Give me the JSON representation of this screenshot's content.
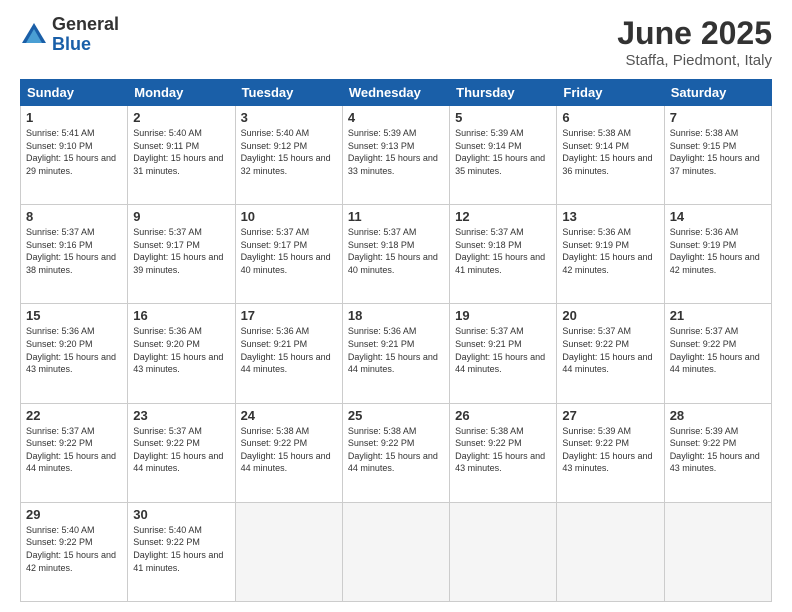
{
  "logo": {
    "general": "General",
    "blue": "Blue"
  },
  "title": {
    "month": "June 2025",
    "location": "Staffa, Piedmont, Italy"
  },
  "weekdays": [
    "Sunday",
    "Monday",
    "Tuesday",
    "Wednesday",
    "Thursday",
    "Friday",
    "Saturday"
  ],
  "days": [
    {
      "num": "1",
      "sunrise": "5:41 AM",
      "sunset": "9:10 PM",
      "daylight": "15 hours and 29 minutes."
    },
    {
      "num": "2",
      "sunrise": "5:40 AM",
      "sunset": "9:11 PM",
      "daylight": "15 hours and 31 minutes."
    },
    {
      "num": "3",
      "sunrise": "5:40 AM",
      "sunset": "9:12 PM",
      "daylight": "15 hours and 32 minutes."
    },
    {
      "num": "4",
      "sunrise": "5:39 AM",
      "sunset": "9:13 PM",
      "daylight": "15 hours and 33 minutes."
    },
    {
      "num": "5",
      "sunrise": "5:39 AM",
      "sunset": "9:14 PM",
      "daylight": "15 hours and 35 minutes."
    },
    {
      "num": "6",
      "sunrise": "5:38 AM",
      "sunset": "9:14 PM",
      "daylight": "15 hours and 36 minutes."
    },
    {
      "num": "7",
      "sunrise": "5:38 AM",
      "sunset": "9:15 PM",
      "daylight": "15 hours and 37 minutes."
    },
    {
      "num": "8",
      "sunrise": "5:37 AM",
      "sunset": "9:16 PM",
      "daylight": "15 hours and 38 minutes."
    },
    {
      "num": "9",
      "sunrise": "5:37 AM",
      "sunset": "9:17 PM",
      "daylight": "15 hours and 39 minutes."
    },
    {
      "num": "10",
      "sunrise": "5:37 AM",
      "sunset": "9:17 PM",
      "daylight": "15 hours and 40 minutes."
    },
    {
      "num": "11",
      "sunrise": "5:37 AM",
      "sunset": "9:18 PM",
      "daylight": "15 hours and 40 minutes."
    },
    {
      "num": "12",
      "sunrise": "5:37 AM",
      "sunset": "9:18 PM",
      "daylight": "15 hours and 41 minutes."
    },
    {
      "num": "13",
      "sunrise": "5:36 AM",
      "sunset": "9:19 PM",
      "daylight": "15 hours and 42 minutes."
    },
    {
      "num": "14",
      "sunrise": "5:36 AM",
      "sunset": "9:19 PM",
      "daylight": "15 hours and 42 minutes."
    },
    {
      "num": "15",
      "sunrise": "5:36 AM",
      "sunset": "9:20 PM",
      "daylight": "15 hours and 43 minutes."
    },
    {
      "num": "16",
      "sunrise": "5:36 AM",
      "sunset": "9:20 PM",
      "daylight": "15 hours and 43 minutes."
    },
    {
      "num": "17",
      "sunrise": "5:36 AM",
      "sunset": "9:21 PM",
      "daylight": "15 hours and 44 minutes."
    },
    {
      "num": "18",
      "sunrise": "5:36 AM",
      "sunset": "9:21 PM",
      "daylight": "15 hours and 44 minutes."
    },
    {
      "num": "19",
      "sunrise": "5:37 AM",
      "sunset": "9:21 PM",
      "daylight": "15 hours and 44 minutes."
    },
    {
      "num": "20",
      "sunrise": "5:37 AM",
      "sunset": "9:22 PM",
      "daylight": "15 hours and 44 minutes."
    },
    {
      "num": "21",
      "sunrise": "5:37 AM",
      "sunset": "9:22 PM",
      "daylight": "15 hours and 44 minutes."
    },
    {
      "num": "22",
      "sunrise": "5:37 AM",
      "sunset": "9:22 PM",
      "daylight": "15 hours and 44 minutes."
    },
    {
      "num": "23",
      "sunrise": "5:37 AM",
      "sunset": "9:22 PM",
      "daylight": "15 hours and 44 minutes."
    },
    {
      "num": "24",
      "sunrise": "5:38 AM",
      "sunset": "9:22 PM",
      "daylight": "15 hours and 44 minutes."
    },
    {
      "num": "25",
      "sunrise": "5:38 AM",
      "sunset": "9:22 PM",
      "daylight": "15 hours and 44 minutes."
    },
    {
      "num": "26",
      "sunrise": "5:38 AM",
      "sunset": "9:22 PM",
      "daylight": "15 hours and 43 minutes."
    },
    {
      "num": "27",
      "sunrise": "5:39 AM",
      "sunset": "9:22 PM",
      "daylight": "15 hours and 43 minutes."
    },
    {
      "num": "28",
      "sunrise": "5:39 AM",
      "sunset": "9:22 PM",
      "daylight": "15 hours and 43 minutes."
    },
    {
      "num": "29",
      "sunrise": "5:40 AM",
      "sunset": "9:22 PM",
      "daylight": "15 hours and 42 minutes."
    },
    {
      "num": "30",
      "sunrise": "5:40 AM",
      "sunset": "9:22 PM",
      "daylight": "15 hours and 41 minutes."
    }
  ]
}
